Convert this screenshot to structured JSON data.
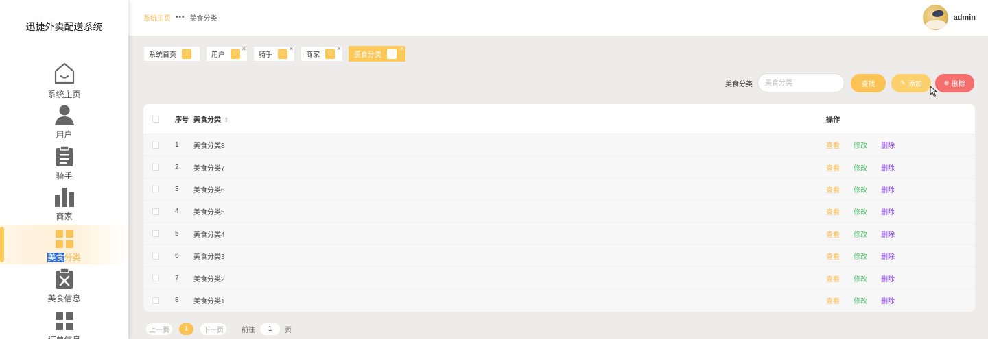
{
  "app": {
    "title": "迅捷外卖配送系统"
  },
  "sidebar": {
    "items": [
      {
        "label": "系统主页",
        "icon": "home-icon"
      },
      {
        "label": "用户",
        "icon": "user-icon"
      },
      {
        "label": "骑手",
        "icon": "clipboard-icon"
      },
      {
        "label": "商家",
        "icon": "bar-chart-icon"
      },
      {
        "label_selected": "美食",
        "label_rest": "分类",
        "icon": "grid-icon",
        "active": true
      },
      {
        "label": "美食信息",
        "icon": "clipboard-x-icon"
      },
      {
        "label": "订单信息",
        "icon": "grid-icon"
      }
    ]
  },
  "header": {
    "breadcrumb": {
      "home": "系统主页",
      "separator": "•••",
      "current": "美食分类"
    },
    "user": {
      "name": "admin"
    }
  },
  "tabs": [
    {
      "label": "系统首页",
      "closable": false
    },
    {
      "label": "用户",
      "closable": true
    },
    {
      "label": "骑手",
      "closable": true
    },
    {
      "label": "商家",
      "closable": true
    },
    {
      "label": "美食分类",
      "closable": true,
      "active": true
    }
  ],
  "tab_close_glyph": "×",
  "search": {
    "label": "美食分类",
    "placeholder": "美食分类",
    "find_button": "查找",
    "add_button": "添加",
    "delete_button": "删除"
  },
  "table": {
    "columns": {
      "index": "序号",
      "name": "美食分类",
      "actions": "操作"
    },
    "rows": [
      {
        "index": "1",
        "name": "美食分类8"
      },
      {
        "index": "2",
        "name": "美食分类7"
      },
      {
        "index": "3",
        "name": "美食分类6"
      },
      {
        "index": "4",
        "name": "美食分类5"
      },
      {
        "index": "5",
        "name": "美食分类4"
      },
      {
        "index": "6",
        "name": "美食分类3"
      },
      {
        "index": "7",
        "name": "美食分类2"
      },
      {
        "index": "8",
        "name": "美食分类1"
      }
    ],
    "actions": {
      "view": "查看",
      "edit": "修改",
      "delete": "删除"
    }
  },
  "pagination": {
    "prev": "上一页",
    "current": "1",
    "next": "下一页",
    "goto_label": "前往",
    "goto_value": "1",
    "page_unit": "页"
  },
  "colors": {
    "accent": "#fbc356",
    "danger": "#f66f6f",
    "edit": "#4cc36d",
    "delete_link": "#7b2fe0"
  }
}
